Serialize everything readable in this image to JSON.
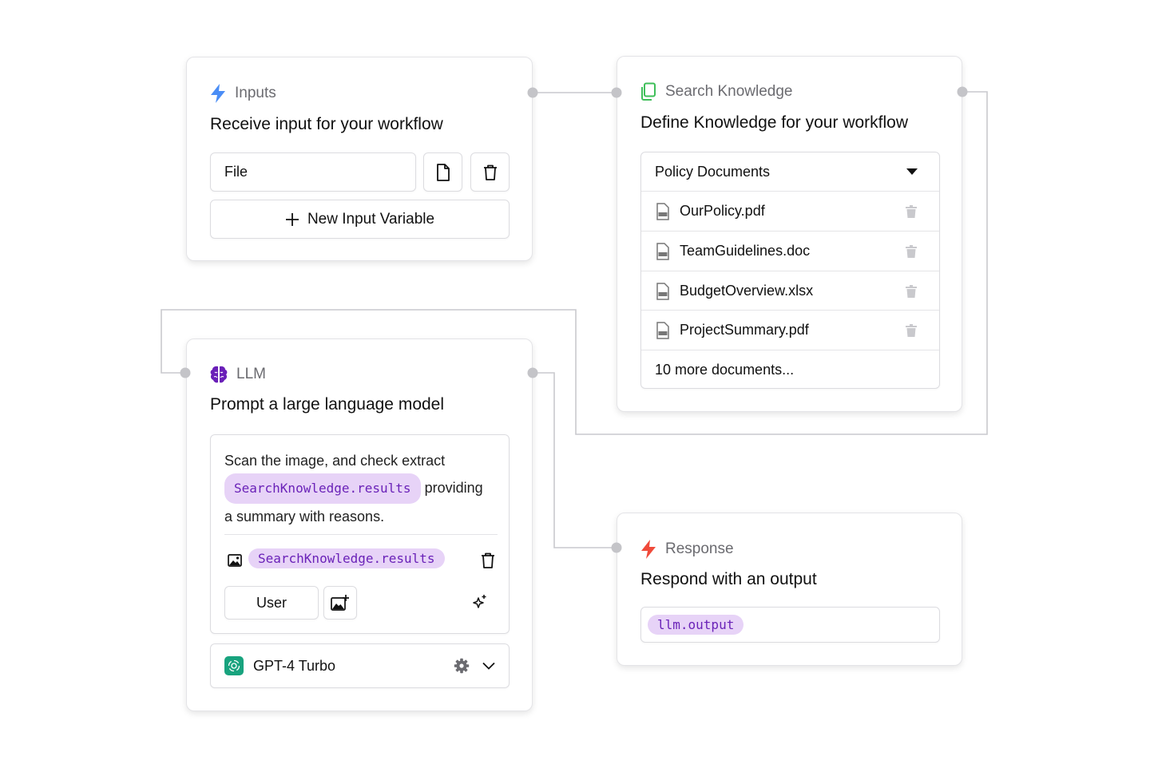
{
  "inputs_node": {
    "label": "Inputs",
    "title": "Receive input for your workflow",
    "field_value": "File",
    "add_label": "New Input Variable"
  },
  "knowledge_node": {
    "label": "Search Knowledge",
    "title": "Define Knowledge for your workflow",
    "selected_source": "Policy Documents",
    "documents": [
      "OurPolicy.pdf",
      "TeamGuidelines.doc",
      "BudgetOverview.xlsx",
      "ProjectSummary.pdf"
    ],
    "more_label": "10 more documents..."
  },
  "llm_node": {
    "label": "LLM",
    "title": "Prompt a large language model",
    "prompt_text_1": "Scan the image, and check extract",
    "prompt_variable": "SearchKnowledge.results",
    "prompt_text_2": "providing",
    "prompt_text_3": "a summary with reasons.",
    "image_variable": "SearchKnowledge.results",
    "role_label": "User",
    "model_name": "GPT-4 Turbo"
  },
  "response_node": {
    "label": "Response",
    "title": "Respond with an output",
    "output_variable": "llm.output"
  },
  "icons": {
    "inputs": "lightning-icon",
    "knowledge": "documents-icon",
    "llm": "brain-icon",
    "response": "lightning-icon",
    "model": "openai-icon"
  },
  "colors": {
    "inputs_accent": "#4a8df6",
    "knowledge_accent": "#3fbf5a",
    "llm_accent": "#6a1fb8",
    "response_accent": "#f04a3a",
    "variable_pill_bg": "#e7d3f7",
    "variable_pill_text": "#6a22b8",
    "model_badge": "#18a37e"
  }
}
